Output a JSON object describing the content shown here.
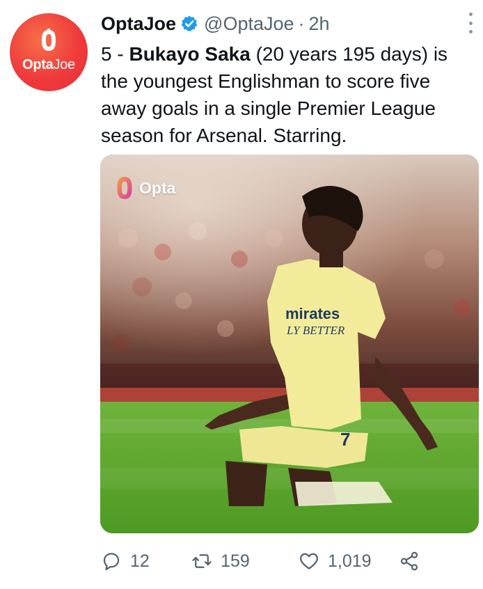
{
  "avatar": {
    "brand_opta": "Opta",
    "brand_joe": "Joe",
    "accent": "#ef3b3b"
  },
  "header": {
    "display_name": "OptaJoe",
    "handle": "@OptaJoe",
    "separator": "·",
    "time": "2h",
    "verified_color": "#1d9bf0"
  },
  "tweet": {
    "prefix": "5 - ",
    "player": "Bukayo Saka",
    "rest": " (20 years 195 days) is the youngest Englishman to score five away goals in a single Premier League season for Arsenal. Starring."
  },
  "media": {
    "watermark": "Opta",
    "shirt_sponsor_line1": "mirates",
    "shirt_sponsor_line2": "LY BETTER",
    "shirt_number": "7",
    "shirt_color": "#f2ec9a"
  },
  "actions": {
    "replies": "12",
    "retweets": "159",
    "likes": "1,019"
  },
  "colors": {
    "muted": "#536471",
    "text": "#0f1419"
  }
}
